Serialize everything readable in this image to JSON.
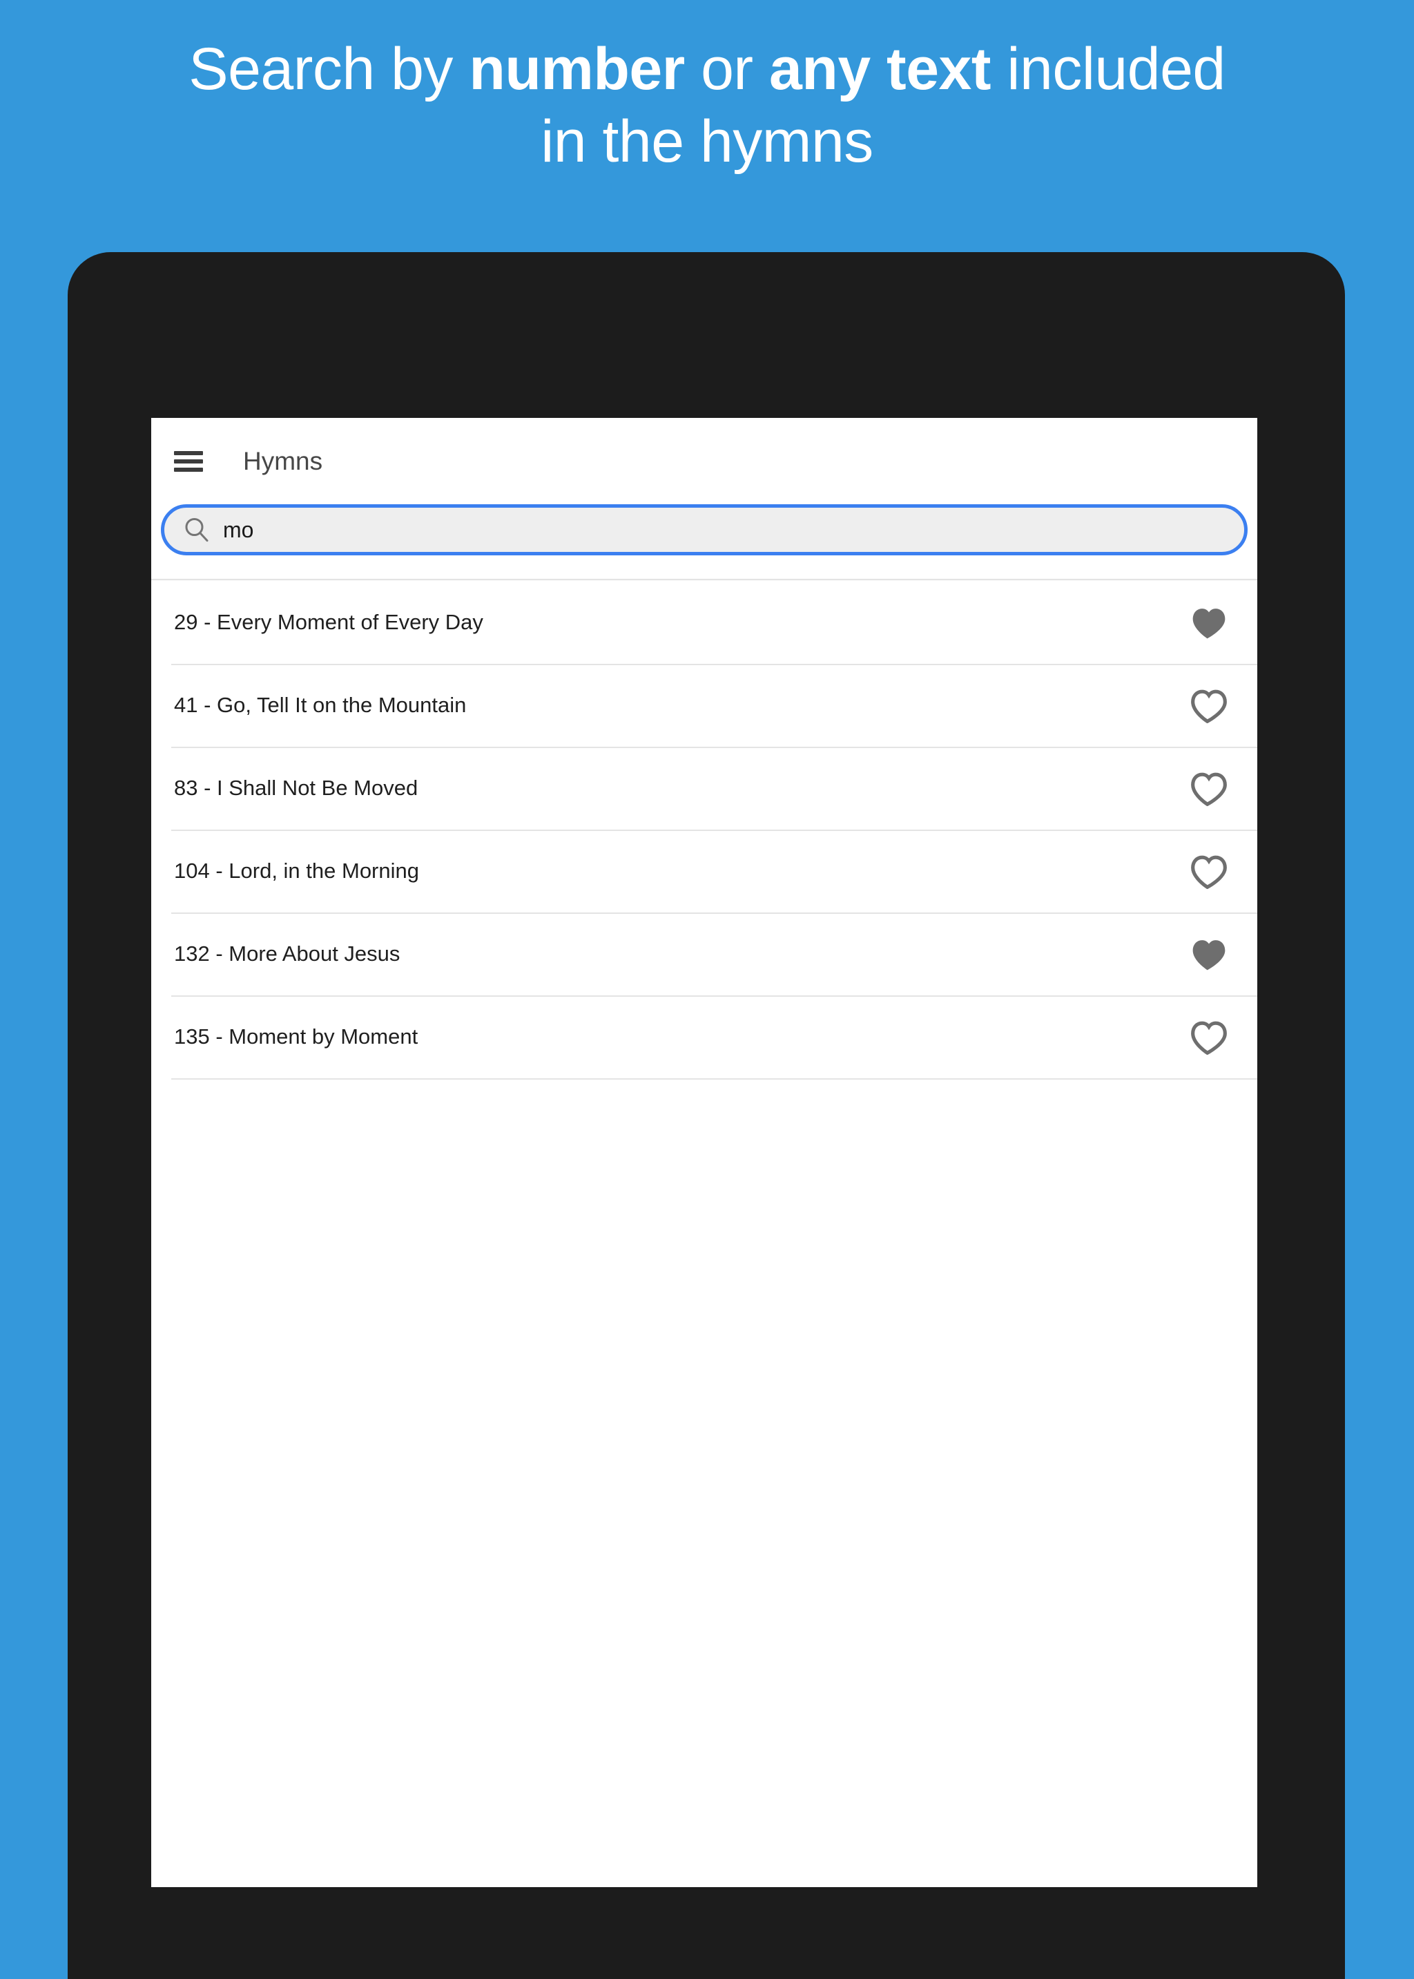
{
  "promo": {
    "line1_part1": "Search by ",
    "line1_bold1": "number",
    "line1_part2": " or ",
    "line1_bold2": "any text",
    "line1_part3": " included",
    "line2": "in the hymns",
    "full_text": "Search by number or any text included in the hymns",
    "background_color": "#3498db",
    "text_color": "#ffffff"
  },
  "app": {
    "title": "Hymns",
    "menu_icon": "hamburger-icon",
    "accent_color": "#3b7ff0"
  },
  "search": {
    "icon": "search-icon",
    "value": "mo",
    "placeholder": "Search",
    "border_color": "#3b7ff0",
    "field_color": "#eeeeee"
  },
  "list": {
    "favorite_icon_filled": "heart-filled-icon",
    "favorite_icon_outline": "heart-outline-icon",
    "favorite_color": "#6e6e6e",
    "items": [
      {
        "label": "29 - Every Moment of Every Day",
        "number": "29",
        "title": "Every Moment of Every Day",
        "favorite": true
      },
      {
        "label": "41 - Go, Tell It on the Mountain",
        "number": "41",
        "title": "Go, Tell It on the Mountain",
        "favorite": false
      },
      {
        "label": "83 - I Shall Not Be Moved",
        "number": "83",
        "title": "I Shall Not Be Moved",
        "favorite": false
      },
      {
        "label": "104 - Lord, in the Morning",
        "number": "104",
        "title": "Lord, in the Morning",
        "favorite": false
      },
      {
        "label": "132 - More About Jesus",
        "number": "132",
        "title": "More About Jesus",
        "favorite": true
      },
      {
        "label": "135 - Moment by Moment",
        "number": "135",
        "title": "Moment by Moment",
        "favorite": false
      }
    ]
  }
}
